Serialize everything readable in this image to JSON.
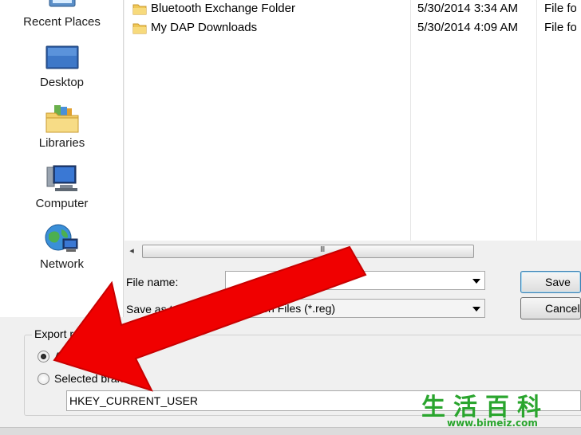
{
  "sidebar": {
    "items": [
      {
        "label": "Recent Places",
        "icon": "recent-places-icon"
      },
      {
        "label": "Desktop",
        "icon": "desktop-icon"
      },
      {
        "label": "Libraries",
        "icon": "libraries-icon"
      },
      {
        "label": "Computer",
        "icon": "computer-icon"
      },
      {
        "label": "Network",
        "icon": "network-icon"
      }
    ]
  },
  "files": [
    {
      "name": "Bluetooth Exchange Folder",
      "date": "5/30/2014 3:34 AM",
      "type": "File folder",
      "icon": "folder-icon"
    },
    {
      "name": "My DAP Downloads",
      "date": "5/30/2014 4:09 AM",
      "type": "File folder",
      "icon": "folder-icon"
    }
  ],
  "scrollbar": {
    "left_arrow": "◂",
    "grip": "III"
  },
  "form": {
    "file_name_label": "File name:",
    "file_name_value": "",
    "save_as_label": "Save as t",
    "save_as_value": "gistration Files (*.reg)"
  },
  "buttons": {
    "save": "Save",
    "cancel": "Cancel"
  },
  "export_range": {
    "title": "Export ranc",
    "all_label": "All",
    "selected_label": "Selected branch",
    "selected_option": "all",
    "branch_value": "HKEY_CURRENT_USER"
  },
  "watermark": {
    "title": "生活百科",
    "url": "www.bimeiz.com"
  },
  "colors": {
    "arrow": "#f00000",
    "watermark": "#2aa52e",
    "default_button_border": "#3c7fb1"
  }
}
